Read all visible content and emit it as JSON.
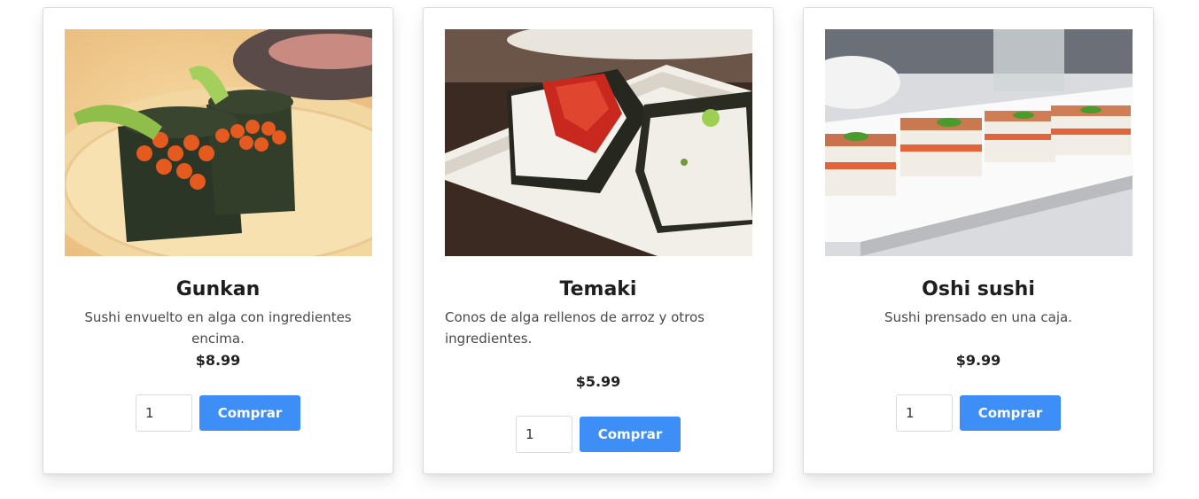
{
  "products": [
    {
      "name": "Gunkan",
      "description": "Sushi envuelto en alga con ingredientes encima.",
      "price": "$8.99",
      "quantity": "1",
      "buy_label": "Comprar",
      "image_icon": "gunkan-sushi-photo"
    },
    {
      "name": "Temaki",
      "description": "Conos de alga rellenos de arroz y otros ingredientes.",
      "price": "$5.99",
      "quantity": "1",
      "buy_label": "Comprar",
      "image_icon": "temaki-sushi-photo"
    },
    {
      "name": "Oshi sushi",
      "description": "Sushi prensado en una caja.",
      "price": "$9.99",
      "quantity": "1",
      "buy_label": "Comprar",
      "image_icon": "oshi-sushi-photo"
    }
  ],
  "colors": {
    "button": "#3e8ef7",
    "button_text": "#ffffff",
    "card_border": "#dcdcdc"
  }
}
